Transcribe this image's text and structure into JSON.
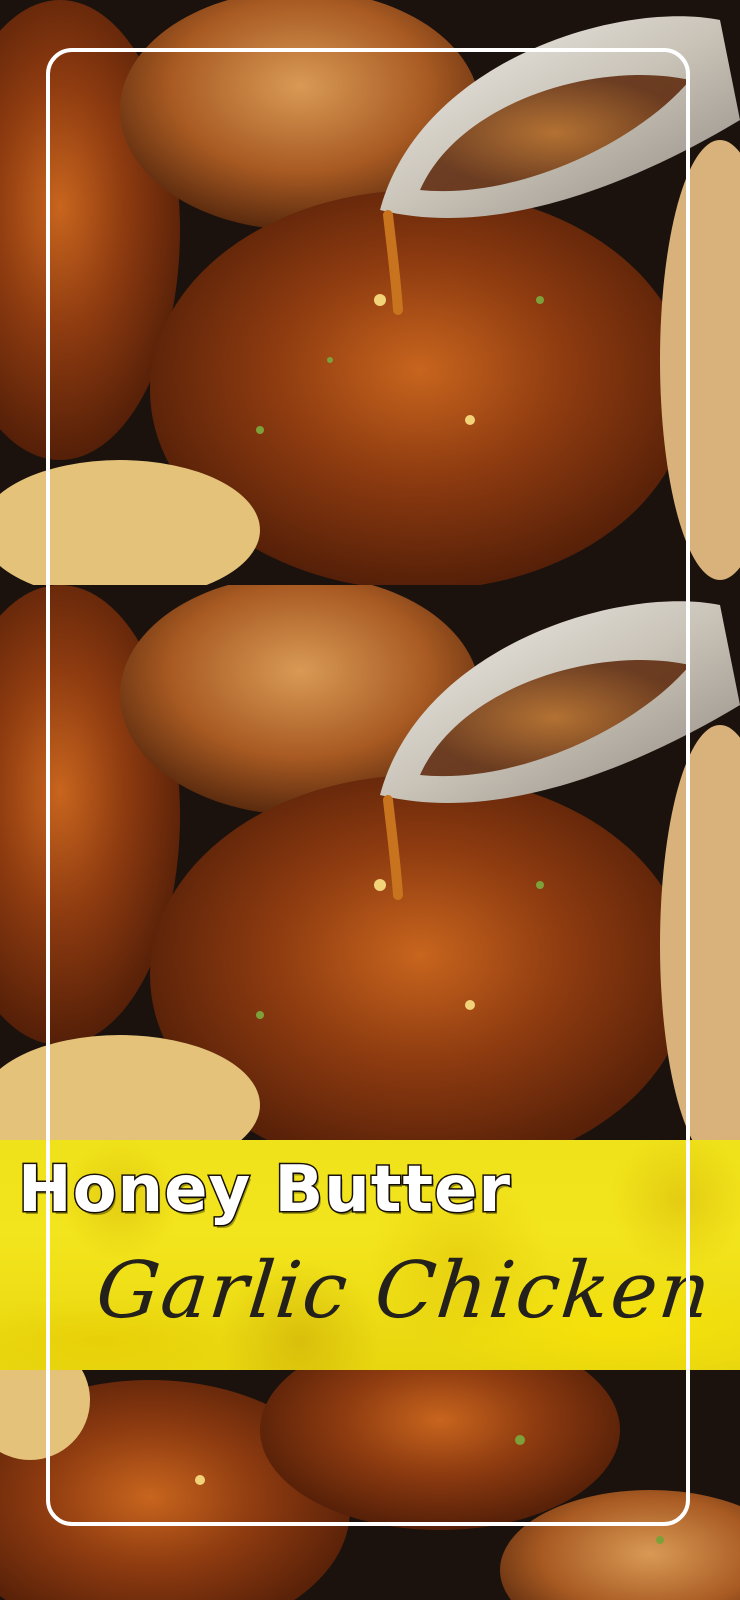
{
  "pin": {
    "title_line1": "Honey Butter",
    "title_line2": "Garlic Chicken"
  },
  "photos": {
    "top": "glazed-chicken-thigh-with-spoon",
    "middle": "glazed-chicken-thigh-with-spoon",
    "bottom": "glazed-chicken-in-skillet"
  },
  "colors": {
    "banner": "#f0e21a",
    "title_primary": "#ffffff",
    "title_outline": "#1b1208",
    "title_script": "#24201b",
    "frame": "#ffffff"
  }
}
